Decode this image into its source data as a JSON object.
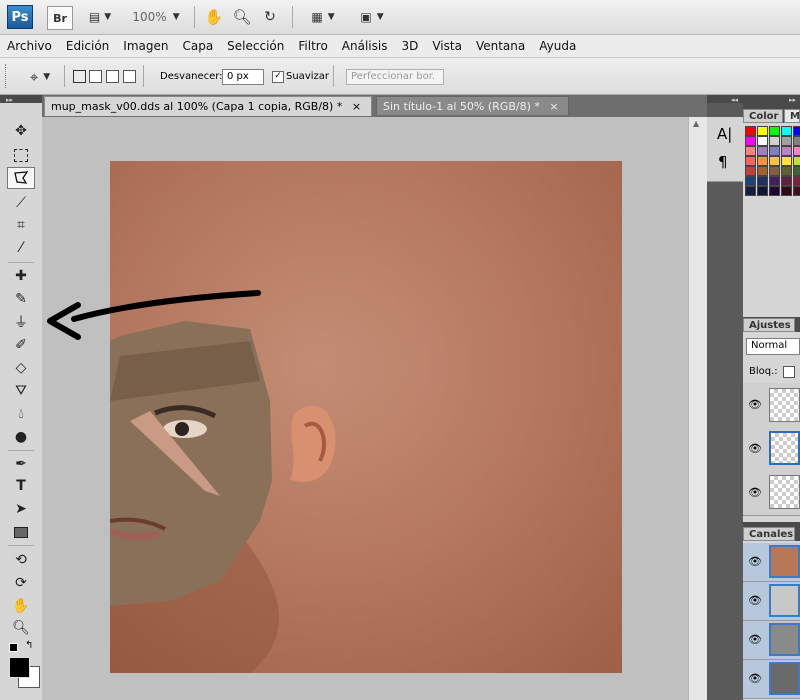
{
  "app": {
    "logo": "Ps",
    "bridge_label": "Br",
    "zoom_value": "100%"
  },
  "menu": [
    "Archivo",
    "Edición",
    "Imagen",
    "Capa",
    "Selección",
    "Filtro",
    "Análisis",
    "3D",
    "Vista",
    "Ventana",
    "Ayuda"
  ],
  "options": {
    "feather_label": "Desvanecer:",
    "feather_value": "0 px",
    "antialias_label": "Suavizar",
    "refine_edge_label": "Perfeccionar bor."
  },
  "tabs": [
    {
      "label": "mup_mask_v00.dds al 100% (Capa 1 copia, RGB/8) *",
      "close": "×"
    },
    {
      "label": "Sin título-1 al 50% (RGB/8) *",
      "close": "×"
    }
  ],
  "panels": {
    "color_tab": "Color",
    "color_tab2": "M",
    "adjust_tab": "Ajustes",
    "blend_mode": "Normal",
    "lock_label": "Bloq.:",
    "channels_tab": "Canales"
  },
  "colors": {
    "accent": "#1b5a98",
    "canvas_bg": "#c0c0c0",
    "skin": "#b27258"
  },
  "icons": {
    "move": "move-icon",
    "marquee": "marquee-icon",
    "lasso": "polygonal-lasso-icon",
    "magic_wand": "magic-wand-icon",
    "crop": "crop-icon",
    "eyedropper": "eyedropper-icon",
    "healing": "healing-brush-icon",
    "brush": "brush-icon",
    "stamp": "clone-stamp-icon",
    "history": "history-brush-icon",
    "eraser": "eraser-icon",
    "bucket": "paint-bucket-icon",
    "blur": "blur-icon",
    "dodge": "dodge-icon",
    "pen": "pen-icon",
    "type": "type-icon",
    "path": "path-selection-icon",
    "shape": "rectangle-shape-icon",
    "rotate3d": "3d-rotate-icon",
    "orbit3d": "3d-orbit-icon",
    "hand": "hand-icon",
    "zoom": "zoom-icon"
  }
}
